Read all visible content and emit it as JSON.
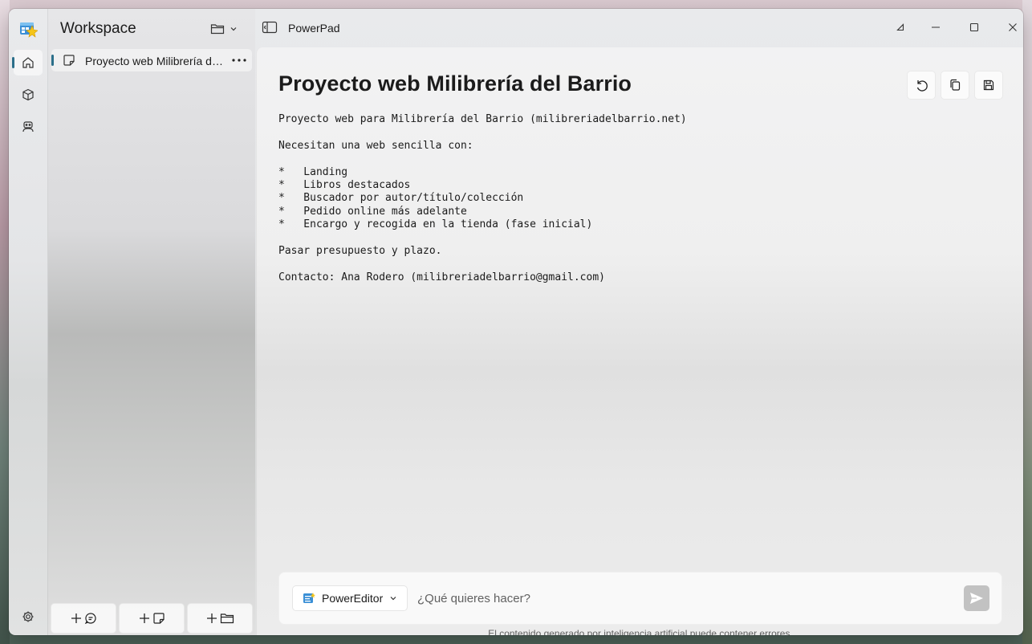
{
  "app": {
    "title": "PowerPad"
  },
  "sidebar": {
    "title": "Workspace",
    "notes": [
      {
        "label": "Proyecto web Milibrería del Barrio"
      }
    ]
  },
  "nav": {
    "items": [
      "home-icon",
      "box-icon",
      "agent-icon"
    ],
    "settings_icon": "gear-icon"
  },
  "document": {
    "title": "Proyecto web Milibrería del Barrio",
    "body": "Proyecto web para Milibrería del Barrio (milibreriadelbarrio.net)\n\nNecesitan una web sencilla con:\n\n*   Landing\n*   Libros destacados\n*   Buscador por autor/título/colección\n*   Pedido online más adelante\n*   Encargo y recogida en la tienda (fase inicial)\n\nPasar presupuesto y plazo.\n\nContacto: Ana Rodero (milibreriadelbarrio@gmail.com)"
  },
  "prompt": {
    "agent": "PowerEditor",
    "placeholder": "¿Qué quieres hacer?",
    "disclaimer": "El contenido generado por inteligencia artificial puede contener errores."
  },
  "colors": {
    "accent": "#2b6f8a",
    "send_disabled": "#c2c2c2"
  }
}
